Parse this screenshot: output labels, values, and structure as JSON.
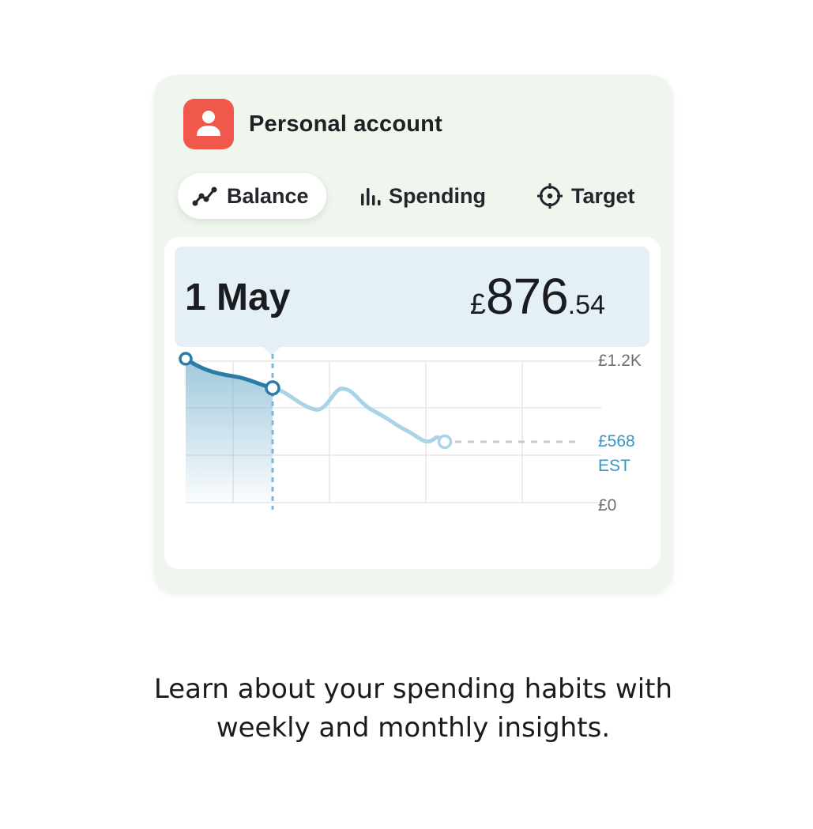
{
  "account": {
    "title": "Personal account",
    "icon": "person-icon",
    "icon_color": "#f0584c"
  },
  "tabs": [
    {
      "label": "Balance",
      "icon": "line-chart-icon",
      "active": true
    },
    {
      "label": "Spending",
      "icon": "bar-chart-icon",
      "active": false
    },
    {
      "label": "Target",
      "icon": "target-icon",
      "active": false
    }
  ],
  "summary": {
    "date": "1 May",
    "currency_symbol": "£",
    "amount_main": "876",
    "amount_decimal": ".54"
  },
  "chart_data": {
    "type": "line",
    "y_ticks": [
      "£1.2K",
      "£0"
    ],
    "estimate_label": "£568",
    "estimate_suffix": "EST",
    "accent_color": "#2a7ca6",
    "projection_color": "#a9d3e6",
    "grid": true
  },
  "caption": {
    "line1": "Learn about your spending habits with",
    "line2": "weekly and monthly insights."
  }
}
